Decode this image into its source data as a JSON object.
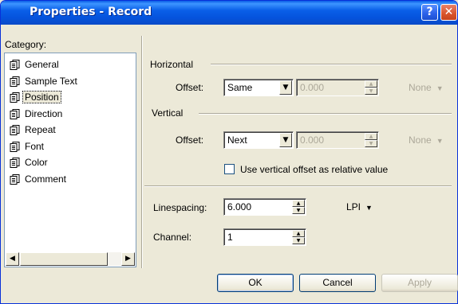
{
  "window": {
    "title": "Properties - Record"
  },
  "titlebar": {
    "help_glyph": "?",
    "close_glyph": "✕"
  },
  "category": {
    "label": "Category:",
    "items": [
      {
        "label": "General",
        "icon": "document-icon"
      },
      {
        "label": "Sample Text",
        "icon": "document-icon"
      },
      {
        "label": "Position",
        "icon": "document-icon",
        "selected": true
      },
      {
        "label": "Direction",
        "icon": "document-icon"
      },
      {
        "label": "Repeat",
        "icon": "document-icon"
      },
      {
        "label": "Font",
        "icon": "document-icon"
      },
      {
        "label": "Color",
        "icon": "document-icon"
      },
      {
        "label": "Comment",
        "icon": "document-icon"
      }
    ]
  },
  "horizontal": {
    "heading": "Horizontal",
    "offset_label": "Offset:",
    "offset_value": "Same",
    "amount_value": "0.000",
    "unit": "None"
  },
  "vertical": {
    "heading": "Vertical",
    "offset_label": "Offset:",
    "offset_value": "Next",
    "amount_value": "0.000",
    "unit": "None",
    "relative_checkbox_label": "Use vertical offset as relative value",
    "relative_checked": false
  },
  "linespacing": {
    "label": "Linespacing:",
    "value": "6.000",
    "unit": "LPI"
  },
  "channel": {
    "label": "Channel:",
    "value": "1"
  },
  "buttons": {
    "ok": "OK",
    "cancel": "Cancel",
    "apply": "Apply"
  }
}
